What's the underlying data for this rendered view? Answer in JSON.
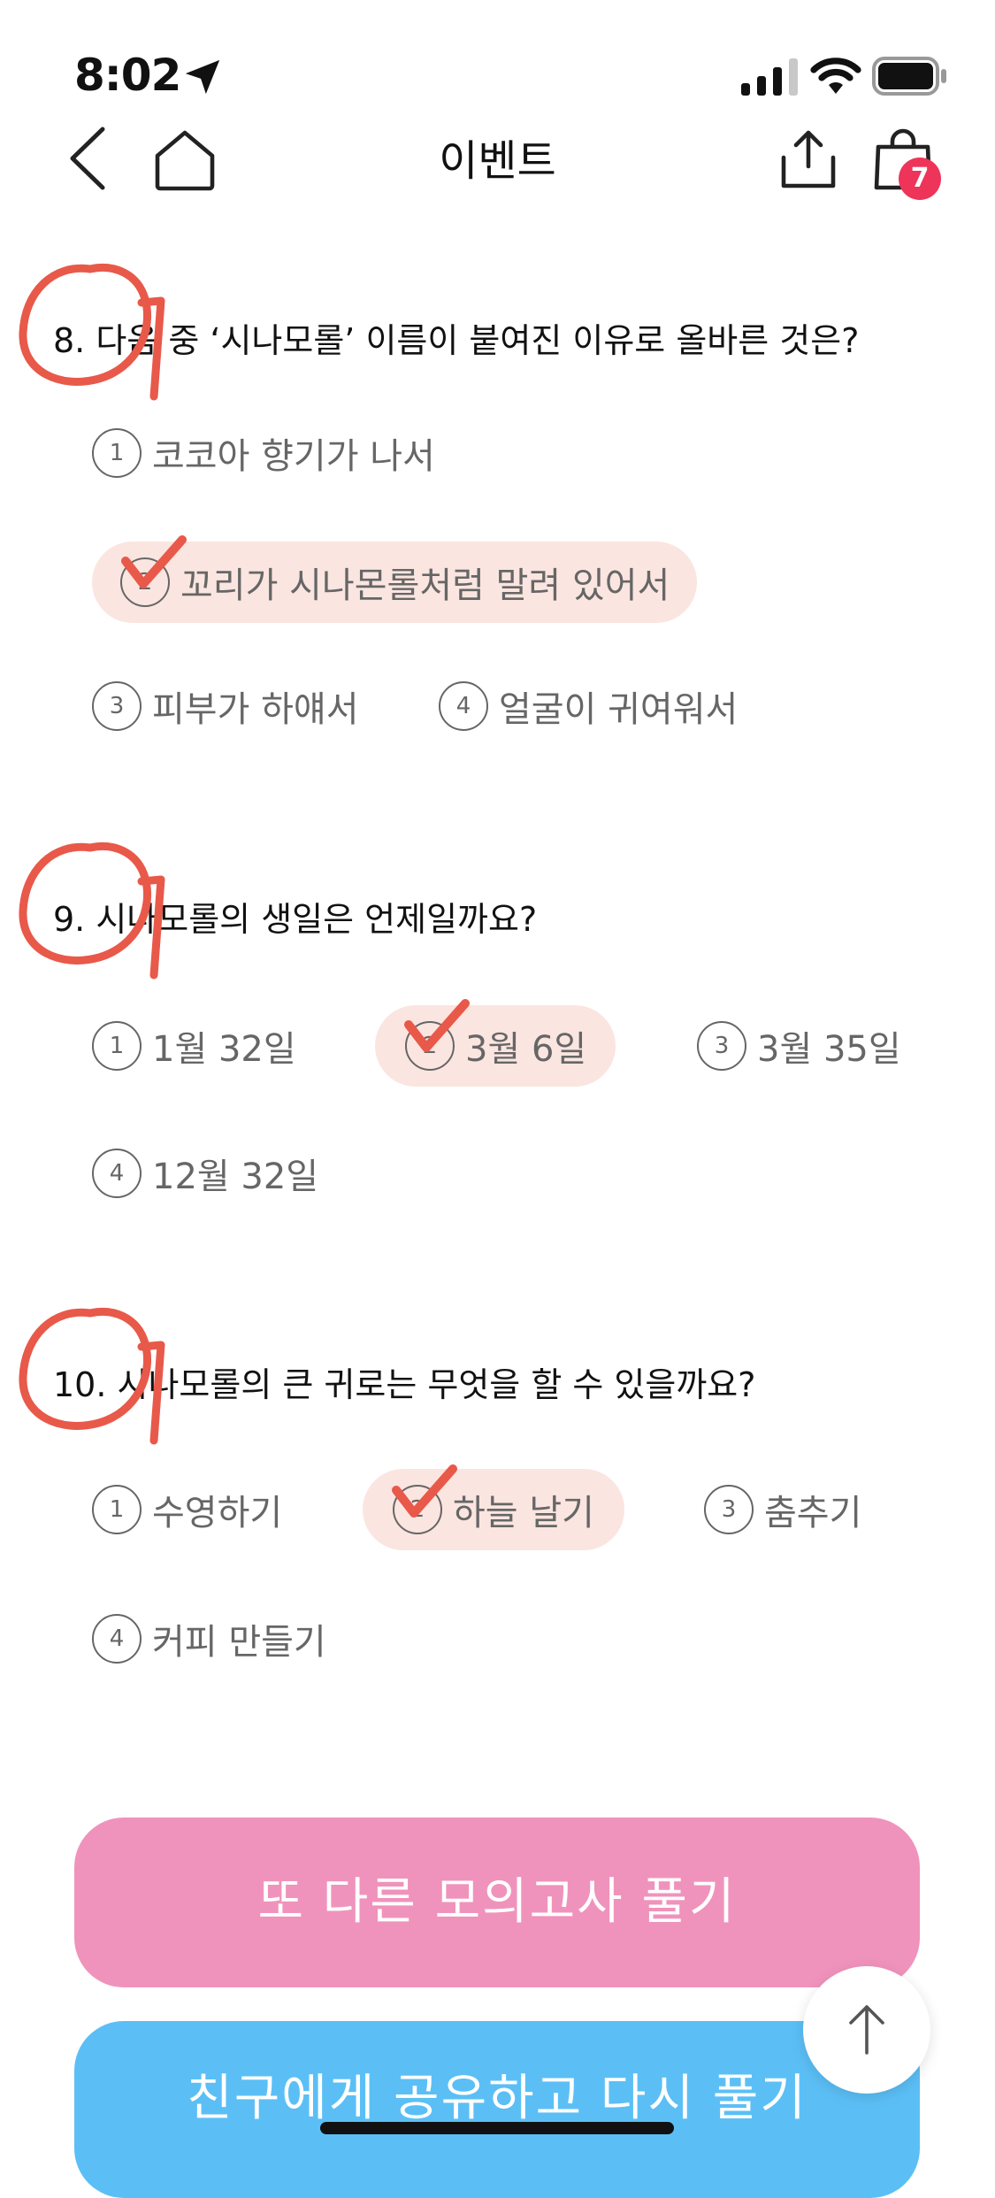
{
  "status_bar": {
    "time": "8:02"
  },
  "nav": {
    "title": "이벤트",
    "cart_count": "7"
  },
  "questions": [
    {
      "title": "8. 다음 중 ‘시나모롤’ 이름이 붙여진 이유로 올바른 것은?",
      "options": [
        {
          "num": "1",
          "label": "코코아 향기가 나서"
        },
        {
          "num": "2",
          "label": "꼬리가 시나몬롤처럼 말려 있어서"
        },
        {
          "num": "3",
          "label": "피부가 하얘서"
        },
        {
          "num": "4",
          "label": "얼굴이 귀여워서"
        }
      ],
      "selected": "2"
    },
    {
      "title": "9. 시나모롤의 생일은 언제일까요?",
      "options": [
        {
          "num": "1",
          "label": "1월 32일"
        },
        {
          "num": "2",
          "label": "3월 6일"
        },
        {
          "num": "3",
          "label": "3월 35일"
        },
        {
          "num": "4",
          "label": "12월 32일"
        }
      ],
      "selected": "2"
    },
    {
      "title": "10. 시나모롤의 큰 귀로는 무엇을 할 수 있을까요?",
      "options": [
        {
          "num": "1",
          "label": "수영하기"
        },
        {
          "num": "2",
          "label": "하늘 날기"
        },
        {
          "num": "3",
          "label": "춤추기"
        },
        {
          "num": "4",
          "label": "커피 만들기"
        }
      ],
      "selected": "2"
    }
  ],
  "buttons": {
    "another_exam": "또 다른 모의고사 풀기",
    "share_retry": "친구에게 공유하고 다시 풀기"
  },
  "colors": {
    "selected_bg": "#fbe5e0",
    "mark": "#e8594a",
    "pink_button": "#f093bc",
    "blue_button": "#5bbff6",
    "badge": "#ee3459"
  }
}
